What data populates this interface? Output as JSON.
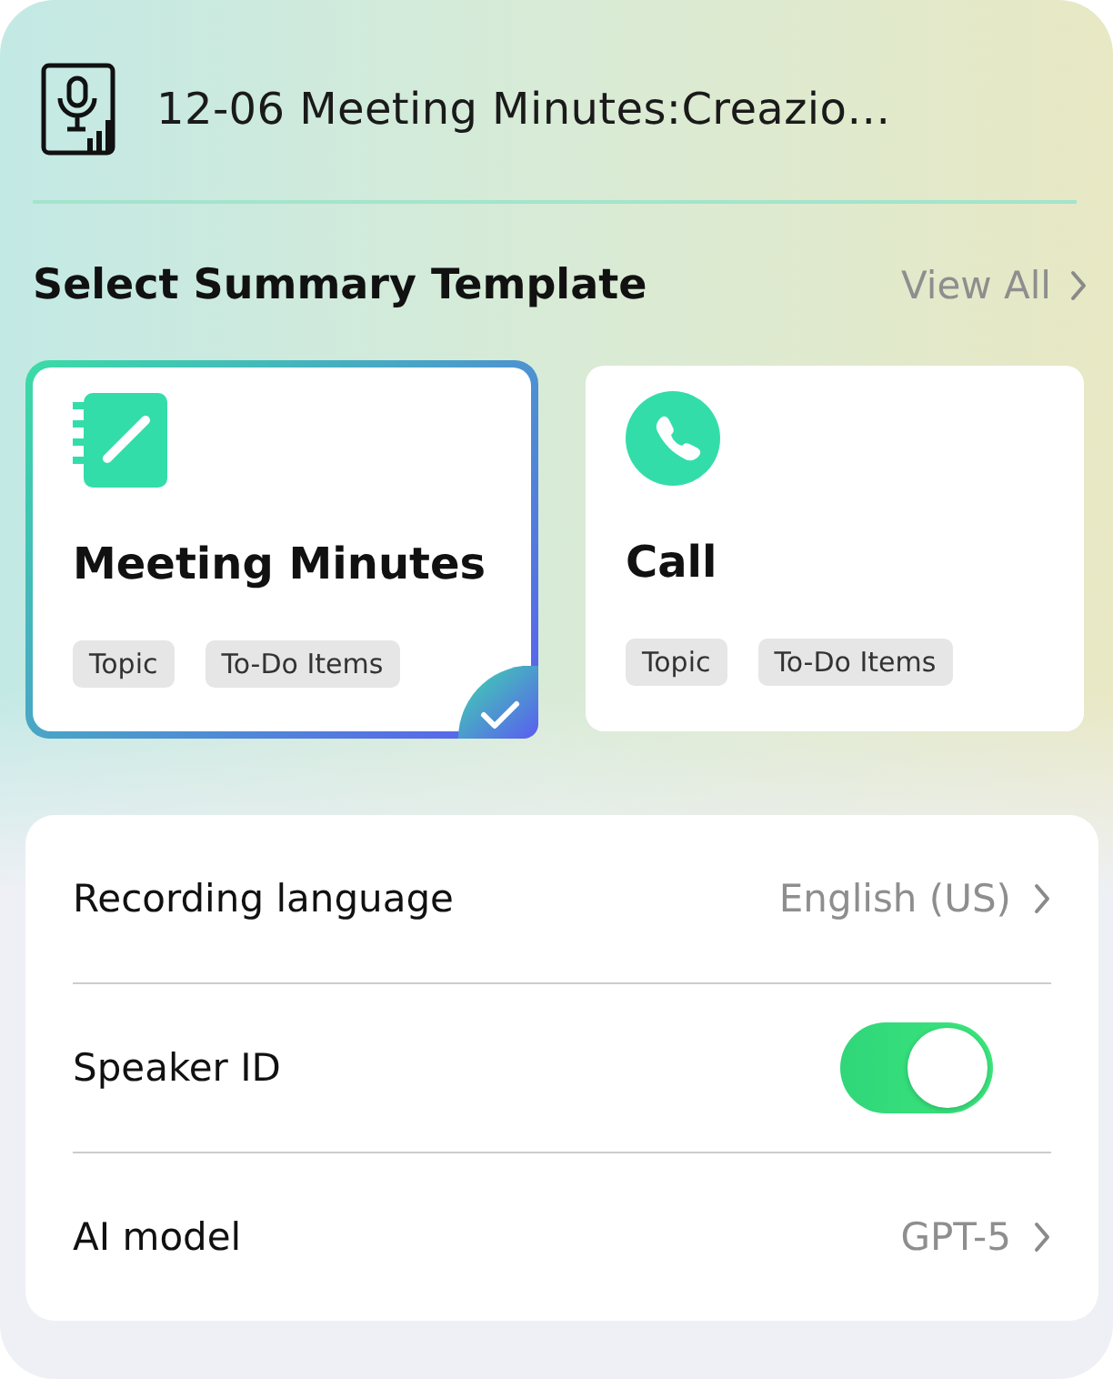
{
  "header": {
    "title": "12-06 Meeting Minutes:Creazio…"
  },
  "templates_section": {
    "title": "Select Summary Template",
    "view_all": "View All"
  },
  "templates": [
    {
      "name": "Meeting Minutes",
      "kind": "notebook",
      "selected": true,
      "tags": [
        "Topic",
        "To-Do Items"
      ]
    },
    {
      "name": "Call",
      "kind": "phone",
      "selected": false,
      "tags": [
        "Topic",
        "To-Do Items"
      ]
    }
  ],
  "settings": [
    {
      "kind": "link",
      "label": "Recording language",
      "value": "English (US)"
    },
    {
      "kind": "toggle",
      "label": "Speaker ID",
      "on": true
    },
    {
      "kind": "link",
      "label": "AI model",
      "value": "GPT-5"
    }
  ]
}
